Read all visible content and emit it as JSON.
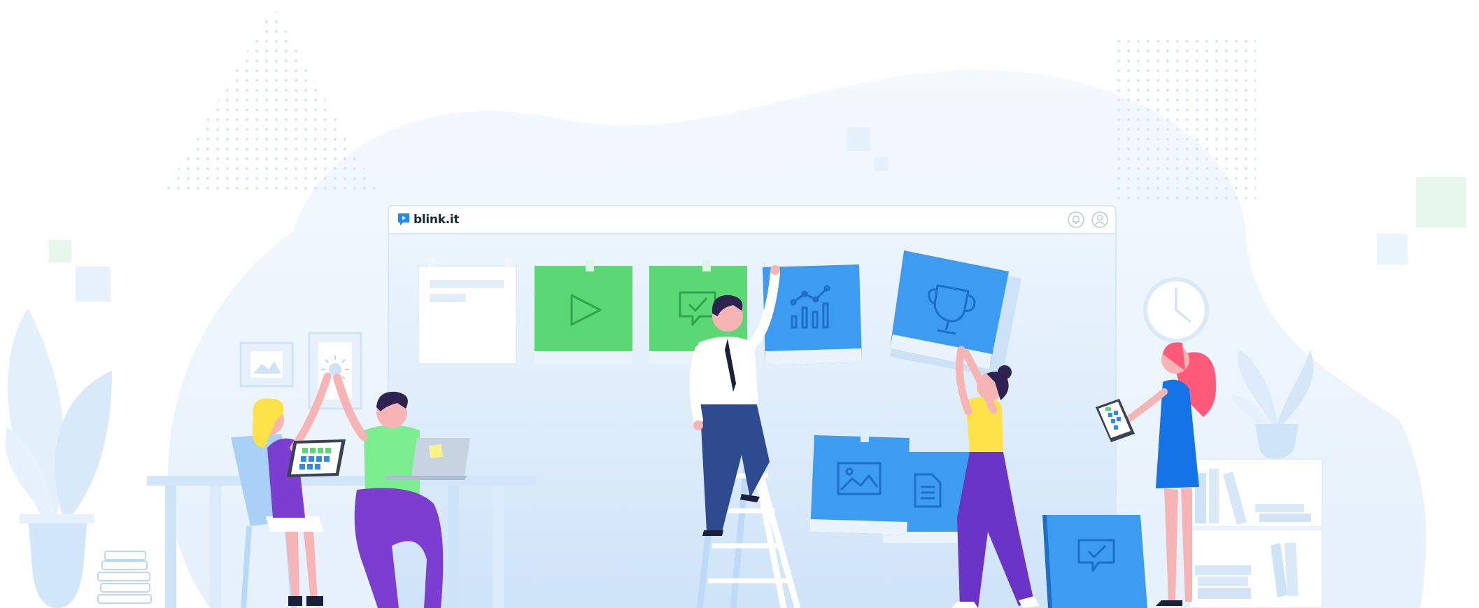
{
  "app": {
    "brand_name": "blink.it",
    "colors": {
      "accent_blue": "#3d9bf0",
      "accent_green": "#5bd873",
      "window_border": "#d6e8f8",
      "text_dark": "#1b2a3a"
    },
    "icons": {
      "logo": "play-speech-bubble-icon",
      "notifications": "bell-icon",
      "account": "user-icon"
    }
  },
  "board": {
    "cards": [
      {
        "kind": "text-note",
        "icon": "text-lines-icon",
        "color": "#ffffff"
      },
      {
        "kind": "video",
        "icon": "play-icon",
        "color": "#5bd873"
      },
      {
        "kind": "approved-comment",
        "icon": "chat-check-icon",
        "color": "#5bd873"
      },
      {
        "kind": "analytics",
        "icon": "bar-chart-icon",
        "color": "#3d9bf0"
      },
      {
        "kind": "achievement",
        "icon": "trophy-icon",
        "color": "#3d9bf0"
      },
      {
        "kind": "image",
        "icon": "image-icon",
        "color": "#3d9bf0"
      },
      {
        "kind": "document",
        "icon": "document-icon",
        "color": "#3d9bf0"
      },
      {
        "kind": "approved-message",
        "icon": "chat-check-icon",
        "color": "#3d9bf0"
      }
    ]
  }
}
